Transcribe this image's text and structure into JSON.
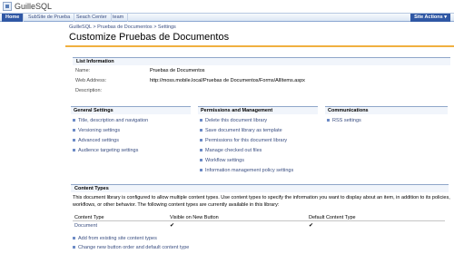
{
  "site": {
    "title": "GuilleSQL"
  },
  "nav": {
    "tabs": [
      {
        "label": "Home"
      },
      {
        "label": "SubSite de Prueba"
      },
      {
        "label": "Seach Center"
      },
      {
        "label": "team"
      }
    ],
    "site_actions": "Site Actions ▾"
  },
  "breadcrumb": "GuilleSQL > Pruebas de Documentos > Settings",
  "page_title": "Customize Pruebas de Documentos",
  "list_information": {
    "header": "List Information",
    "name_label": "Name:",
    "name_value": "Pruebas de Documentos",
    "address_label": "Web Address:",
    "address_value": "http://moss.mobile.local/Pruebas de Documentos/Forms/AllItems.aspx",
    "description_label": "Description:"
  },
  "general_settings": {
    "header": "General Settings",
    "links": [
      "Title, description and navigation",
      "Versioning settings",
      "Advanced settings",
      "Audience targeting settings"
    ]
  },
  "permissions": {
    "header": "Permissions and Management",
    "links": [
      "Delete this document library",
      "Save document library as template",
      "Permissions for this document library",
      "Manage checked out files",
      "Workflow settings",
      "Information management policy settings"
    ]
  },
  "communications": {
    "header": "Communications",
    "links": [
      "RSS settings"
    ]
  },
  "content_types": {
    "header": "Content Types",
    "description": "This document library is configured to allow multiple content types. Use content types to specify the information you want to display about an item, in addition to its policies, workflows, or other behavior. The following content types are currently available in this library:",
    "columns": [
      "Content Type",
      "Visible on New Button",
      "Default Content Type"
    ],
    "rows": [
      {
        "name": "Document",
        "visible": "✔",
        "default": "✔"
      }
    ],
    "links": [
      "Add from existing site content types",
      "Change new button order and default content type"
    ]
  }
}
